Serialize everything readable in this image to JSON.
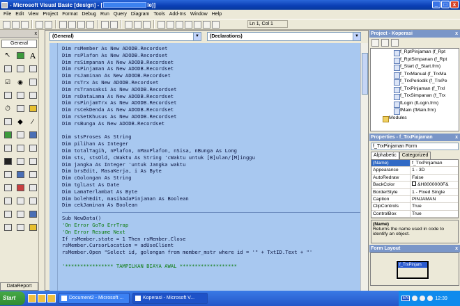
{
  "window": {
    "title_left": "- Microsoft Visual Basic [design] - [",
    "title_right": "le)]",
    "controls": [
      "_",
      "□",
      "x"
    ]
  },
  "menu": [
    "File",
    "Edit",
    "View",
    "Project",
    "Format",
    "Debug",
    "Run",
    "Query",
    "Diagram",
    "Tools",
    "Add-Ins",
    "Window",
    "Help"
  ],
  "toolbar": {
    "position": "Ln 1, Col 1"
  },
  "toolbox": {
    "tab": "General",
    "datareport": "DataReport",
    "close": "x"
  },
  "code": {
    "object_combo": "(General)",
    "proc_combo": "(Declarations)",
    "section1": [
      "Dim rsMember As New ADODB.Recordset",
      "Dim rsPlafon As New ADODB.Recordset",
      "Dim rsSimpanan As New ADODB.Recordset",
      "Dim rsPinjaman As New ADODB.Recordset",
      "Dim rsJaminan As New ADODB.Recordset",
      "Dim rsTrx As New ADODB.Recordset",
      "Dim rsTransaksi As New ADODB.Recordset",
      "Dim rsDataLama As New ADODB.Recordset",
      "Dim rsPinjamTrx As New ADODB.Recordset",
      "Dim rsCekDenda As New ADODB.Recordset",
      "Dim rsSetKhusus As New ADODB.Recordset",
      "Dim rsBunga As New ADODB.Recordset"
    ],
    "section2": [
      "Dim stsProses As String",
      "Dim pilihan As Integer",
      "Dim totalTagih, nPlafon, nMaxPlafon, nSisa, nBunga As Long",
      "Dim sts, stsOld, cWaktu As String 'cWaktu untuk [B]ulan/[M]inggu",
      "Dim jangka As Integer 'untuk Jangka waktu",
      "Dim brsEdit, MasaKerja, i As Byte",
      "Dim cGolongan As String",
      "Dim tglLast As Date",
      "Dim LamaTerlambat As Byte",
      "Dim bolehEdit, masihAdaPinjaman As Boolean",
      "Dim cekJaminan As Boolean"
    ],
    "section3": [
      "Sub NewData()",
      "'On Error GoTo ErrTrap",
      "'On Error Resume Next",
      "If rsMember.state = 1 Then rsMember.Close",
      "rsMember.CursorLocation = adUseClient",
      "rsMember.Open \"Select id, golongan from member_mstr where id = '\" + TxtID.Text + \"'",
      "",
      "'**************** TAMPILKAN BIAYA AWAL *******************"
    ]
  },
  "project": {
    "title": "Project - Koperasi",
    "close": "x",
    "items": [
      "f_RptPinjaman (f_Rpt",
      "f_RptSimpanan (f_Rpt",
      "f_Start (f_Start.frm)",
      "f_TrxManual (f_TrxMa",
      "f_TrxPeriodik (f_TrxPe",
      "f_TrxPinjaman (f_Trxl",
      "f_TrxSimpanan (f_Trx",
      "fLogin (fLogin.frm)",
      "fMain (fMain.frm)"
    ],
    "modules": "Modules"
  },
  "properties": {
    "title": "Properties - f_TrxPinjaman",
    "close": "x",
    "object": "f_TrxPinjaman Form",
    "tabs": [
      "Alphabetic",
      "Categorized"
    ],
    "rows": [
      {
        "name": "(Name)",
        "value": "f_TrxPinjaman"
      },
      {
        "name": "Appearance",
        "value": "1 - 3D"
      },
      {
        "name": "AutoRedraw",
        "value": "False"
      },
      {
        "name": "BackColor",
        "value": "&H8000000F&"
      },
      {
        "name": "BorderStyle",
        "value": "1 - Fixed Single"
      },
      {
        "name": "Caption",
        "value": "PINJAMAN"
      },
      {
        "name": "ClipControls",
        "value": "True"
      },
      {
        "name": "ControlBox",
        "value": "True"
      }
    ],
    "desc_title": "(Name)",
    "desc_text": "Returns the name used in code to identify an object."
  },
  "form_layout": {
    "title": "Form Layout",
    "close": "x",
    "form_caption": "f_TrxPinjam"
  },
  "taskbar": {
    "start": "Start",
    "tasks": [
      "Document2 - Microsoft ...",
      "Koperasi - Microsoft V..."
    ],
    "lang": "EN",
    "clock": "12:39"
  }
}
